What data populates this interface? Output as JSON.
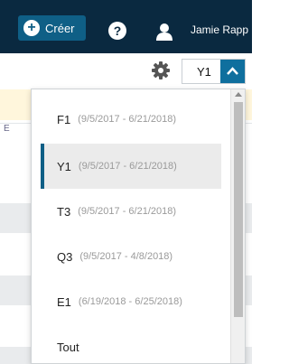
{
  "header": {
    "create_label": "Créer",
    "help_label": "?",
    "user_name": "Jamie Rapp"
  },
  "toolbar": {
    "selected_period": "Y1"
  },
  "table": {
    "partial_header": "E"
  },
  "period_options": [
    {
      "code": "F1",
      "range": "(9/5/2017 - 6/21/2018)",
      "selected": false
    },
    {
      "code": "Y1",
      "range": "(9/5/2017 - 6/21/2018)",
      "selected": true
    },
    {
      "code": "T3",
      "range": "(9/5/2017 - 6/21/2018)",
      "selected": false
    },
    {
      "code": "Q3",
      "range": "(9/5/2017 - 4/8/2018)",
      "selected": false
    },
    {
      "code": "E1",
      "range": "(6/19/2018 - 6/25/2018)",
      "selected": false
    },
    {
      "code": "Tout",
      "range": "",
      "selected": false
    }
  ],
  "colors": {
    "header_bg": "#0a2940",
    "accent": "#0f6f9e",
    "selected_bar": "#0f5f86"
  },
  "icons": [
    "plus-icon",
    "help-icon",
    "user-icon",
    "gear-icon",
    "chevron-up-icon"
  ]
}
